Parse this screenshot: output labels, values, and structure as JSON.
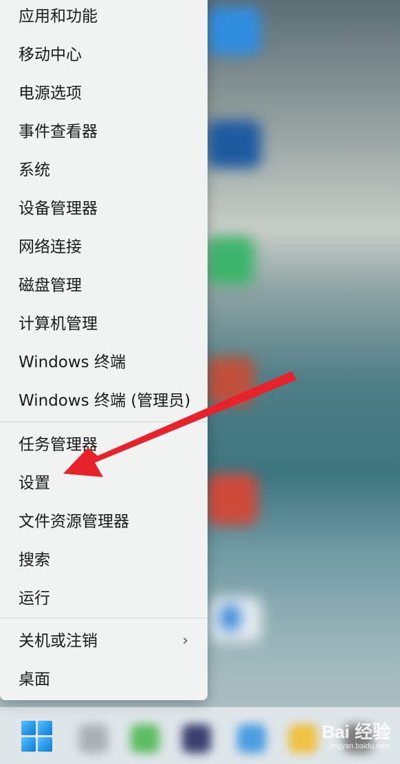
{
  "context_menu": {
    "items": [
      {
        "label": "应用和功能"
      },
      {
        "label": "移动中心"
      },
      {
        "label": "电源选项"
      },
      {
        "label": "事件查看器"
      },
      {
        "label": "系统"
      },
      {
        "label": "设备管理器"
      },
      {
        "label": "网络连接"
      },
      {
        "label": "磁盘管理"
      },
      {
        "label": "计算机管理"
      },
      {
        "label": "Windows 终端"
      },
      {
        "label": "Windows 终端 (管理员)"
      },
      {
        "label": "任务管理器"
      },
      {
        "label": "设置"
      },
      {
        "label": "文件资源管理器"
      },
      {
        "label": "搜索"
      },
      {
        "label": "运行"
      },
      {
        "label": "关机或注销",
        "submenu_icon": "chevron-right-icon"
      },
      {
        "label": "桌面"
      }
    ]
  },
  "taskbar": {
    "start_icon": "windows-start-icon"
  },
  "annotation": {
    "arrow_color": "#e8222a",
    "points_to": "设置"
  },
  "watermark": {
    "brand": "Bai 经验",
    "domain": "jingyan.baidu.com"
  },
  "colors": {
    "menu_bg": "#f1f3f3",
    "text": "#1a1a1a",
    "taskbar_bg": "#dfe6ea"
  }
}
